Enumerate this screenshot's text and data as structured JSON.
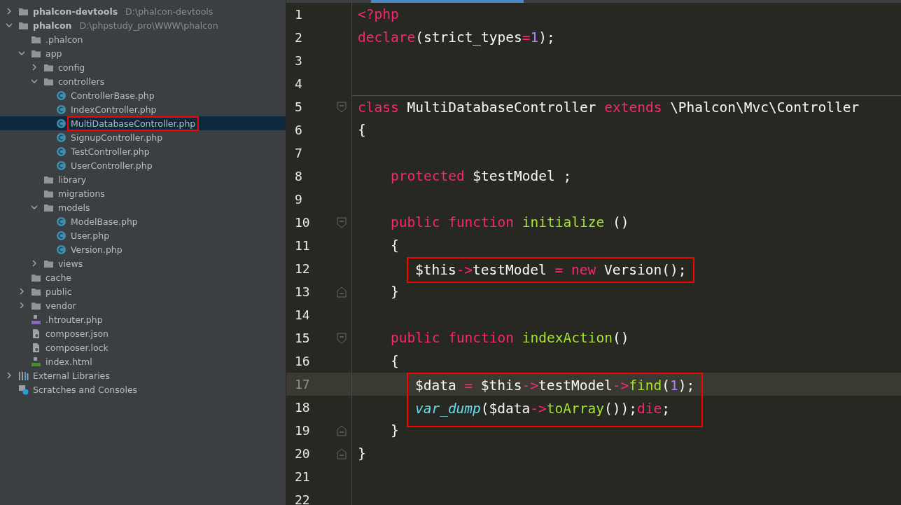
{
  "project_tree": [
    {
      "label": "phalcon-devtools",
      "path": "D:\\phalcon-devtools",
      "kind": "project",
      "expanded": false
    },
    {
      "label": "phalcon",
      "path": "D:\\phpstudy_pro\\WWW\\phalcon",
      "kind": "project",
      "expanded": true,
      "children": [
        {
          "label": ".phalcon",
          "kind": "folder"
        },
        {
          "label": "app",
          "kind": "folder",
          "expanded": true,
          "children": [
            {
              "label": "config",
              "kind": "folder",
              "expanded": false
            },
            {
              "label": "controllers",
              "kind": "folder",
              "expanded": true,
              "children": [
                {
                  "label": "ControllerBase.php",
                  "kind": "class",
                  "selected": false,
                  "marked": false
                },
                {
                  "label": "IndexController.php",
                  "kind": "class",
                  "selected": false,
                  "marked": false
                },
                {
                  "label": "MultiDatabaseController.php",
                  "kind": "class",
                  "selected": true,
                  "marked": true
                },
                {
                  "label": "SignupController.php",
                  "kind": "class",
                  "selected": false,
                  "marked": false
                },
                {
                  "label": "TestController.php",
                  "kind": "class",
                  "selected": false,
                  "marked": false
                },
                {
                  "label": "UserController.php",
                  "kind": "class",
                  "selected": false,
                  "marked": false
                }
              ]
            },
            {
              "label": "library",
              "kind": "folder"
            },
            {
              "label": "migrations",
              "kind": "folder"
            },
            {
              "label": "models",
              "kind": "folder",
              "expanded": true,
              "children": [
                {
                  "label": "ModelBase.php",
                  "kind": "class",
                  "selected": false,
                  "marked": false
                },
                {
                  "label": "User.php",
                  "kind": "class",
                  "selected": false,
                  "marked": false
                },
                {
                  "label": "Version.php",
                  "kind": "class",
                  "selected": false,
                  "marked": false
                }
              ]
            },
            {
              "label": "views",
              "kind": "folder",
              "expanded": false
            }
          ]
        },
        {
          "label": "cache",
          "kind": "folder"
        },
        {
          "label": "public",
          "kind": "folder",
          "expanded": false
        },
        {
          "label": "vendor",
          "kind": "folder",
          "expanded": false
        },
        {
          "label": ".htrouter.php",
          "kind": "php"
        },
        {
          "label": "composer.json",
          "kind": "json"
        },
        {
          "label": "composer.lock",
          "kind": "json"
        },
        {
          "label": "index.html",
          "kind": "html"
        }
      ]
    },
    {
      "label": "External Libraries",
      "kind": "libraries",
      "expanded": false
    },
    {
      "label": "Scratches and Consoles",
      "kind": "scratches"
    }
  ],
  "editor": {
    "lines": [
      {
        "number": "1",
        "current": false,
        "tokens": [
          {
            "kind": "keyword",
            "text": "<?php"
          }
        ]
      },
      {
        "number": "2",
        "current": false,
        "tokens": [
          {
            "kind": "keyword",
            "text": "declare"
          },
          {
            "kind": "plain",
            "text": "(strict_types"
          },
          {
            "kind": "operator",
            "text": "="
          },
          {
            "kind": "number",
            "text": "1"
          },
          {
            "kind": "plain",
            "text": ");"
          }
        ]
      },
      {
        "number": "3",
        "current": false
      },
      {
        "number": "4",
        "current": false
      },
      {
        "number": "5",
        "current": false,
        "fold_start": true,
        "separator": true,
        "tokens": [
          {
            "kind": "keyword",
            "text": "class"
          },
          {
            "kind": "plain",
            "text": " MultiDatabaseController "
          },
          {
            "kind": "keyword",
            "text": "extends"
          },
          {
            "kind": "plain",
            "text": " \\Phalcon\\Mvc\\Controller"
          }
        ]
      },
      {
        "number": "6",
        "current": false,
        "tokens": [
          {
            "kind": "plain",
            "text": "{"
          }
        ]
      },
      {
        "number": "7",
        "current": false
      },
      {
        "number": "8",
        "current": false,
        "tokens": [
          {
            "kind": "keyword",
            "text": "    protected"
          },
          {
            "kind": "plain",
            "text": " $testModel ;"
          }
        ]
      },
      {
        "number": "9",
        "current": false
      },
      {
        "number": "10",
        "current": false,
        "fold_start": true,
        "tokens": [
          {
            "kind": "keyword",
            "text": "    public function "
          },
          {
            "kind": "function",
            "text": "initialize"
          },
          {
            "kind": "plain",
            "text": " ()"
          }
        ]
      },
      {
        "number": "11",
        "current": false,
        "tokens": [
          {
            "kind": "plain",
            "text": "    {"
          }
        ]
      },
      {
        "number": "12",
        "current": false,
        "marked": true,
        "tokens": [
          {
            "kind": "plain",
            "text": "        $this"
          },
          {
            "kind": "operator",
            "text": "->"
          },
          {
            "kind": "plain",
            "text": "testModel "
          },
          {
            "kind": "operator",
            "text": "= "
          },
          {
            "kind": "keyword",
            "text": "new"
          },
          {
            "kind": "plain",
            "text": " Version();"
          }
        ]
      },
      {
        "number": "13",
        "current": false,
        "fold_end": true,
        "tokens": [
          {
            "kind": "plain",
            "text": "    }"
          }
        ]
      },
      {
        "number": "14",
        "current": false
      },
      {
        "number": "15",
        "current": false,
        "fold_start": true,
        "tokens": [
          {
            "kind": "keyword",
            "text": "    public function "
          },
          {
            "kind": "function",
            "text": "indexAction"
          },
          {
            "kind": "plain",
            "text": "()"
          }
        ]
      },
      {
        "number": "16",
        "current": false,
        "tokens": [
          {
            "kind": "plain",
            "text": "    {"
          }
        ]
      },
      {
        "number": "17",
        "current": true,
        "marked": true,
        "tokens": [
          {
            "kind": "plain",
            "text": "        $data "
          },
          {
            "kind": "operator",
            "text": "="
          },
          {
            "kind": "plain",
            "text": " $this"
          },
          {
            "kind": "operator",
            "text": "->"
          },
          {
            "kind": "plain",
            "text": "testModel"
          },
          {
            "kind": "operator",
            "text": "->"
          },
          {
            "kind": "function",
            "text": "find"
          },
          {
            "kind": "plain",
            "text": "("
          },
          {
            "kind": "number",
            "text": "1"
          },
          {
            "kind": "plain",
            "text": ");"
          }
        ]
      },
      {
        "number": "18",
        "current": false,
        "marked": true,
        "tokens": [
          {
            "kind": "builtin",
            "text": "        var_dump"
          },
          {
            "kind": "plain",
            "text": "($data"
          },
          {
            "kind": "operator",
            "text": "->"
          },
          {
            "kind": "function",
            "text": "toArray"
          },
          {
            "kind": "plain",
            "text": "());"
          },
          {
            "kind": "keyword",
            "text": "die"
          },
          {
            "kind": "plain",
            "text": ";"
          }
        ]
      },
      {
        "number": "19",
        "current": false,
        "fold_end": true,
        "tokens": [
          {
            "kind": "plain",
            "text": "    }"
          }
        ]
      },
      {
        "number": "20",
        "current": false,
        "fold_end": true,
        "tokens": [
          {
            "kind": "plain",
            "text": "}"
          }
        ]
      },
      {
        "number": "21",
        "current": false
      },
      {
        "number": "22",
        "current": false
      }
    ]
  }
}
